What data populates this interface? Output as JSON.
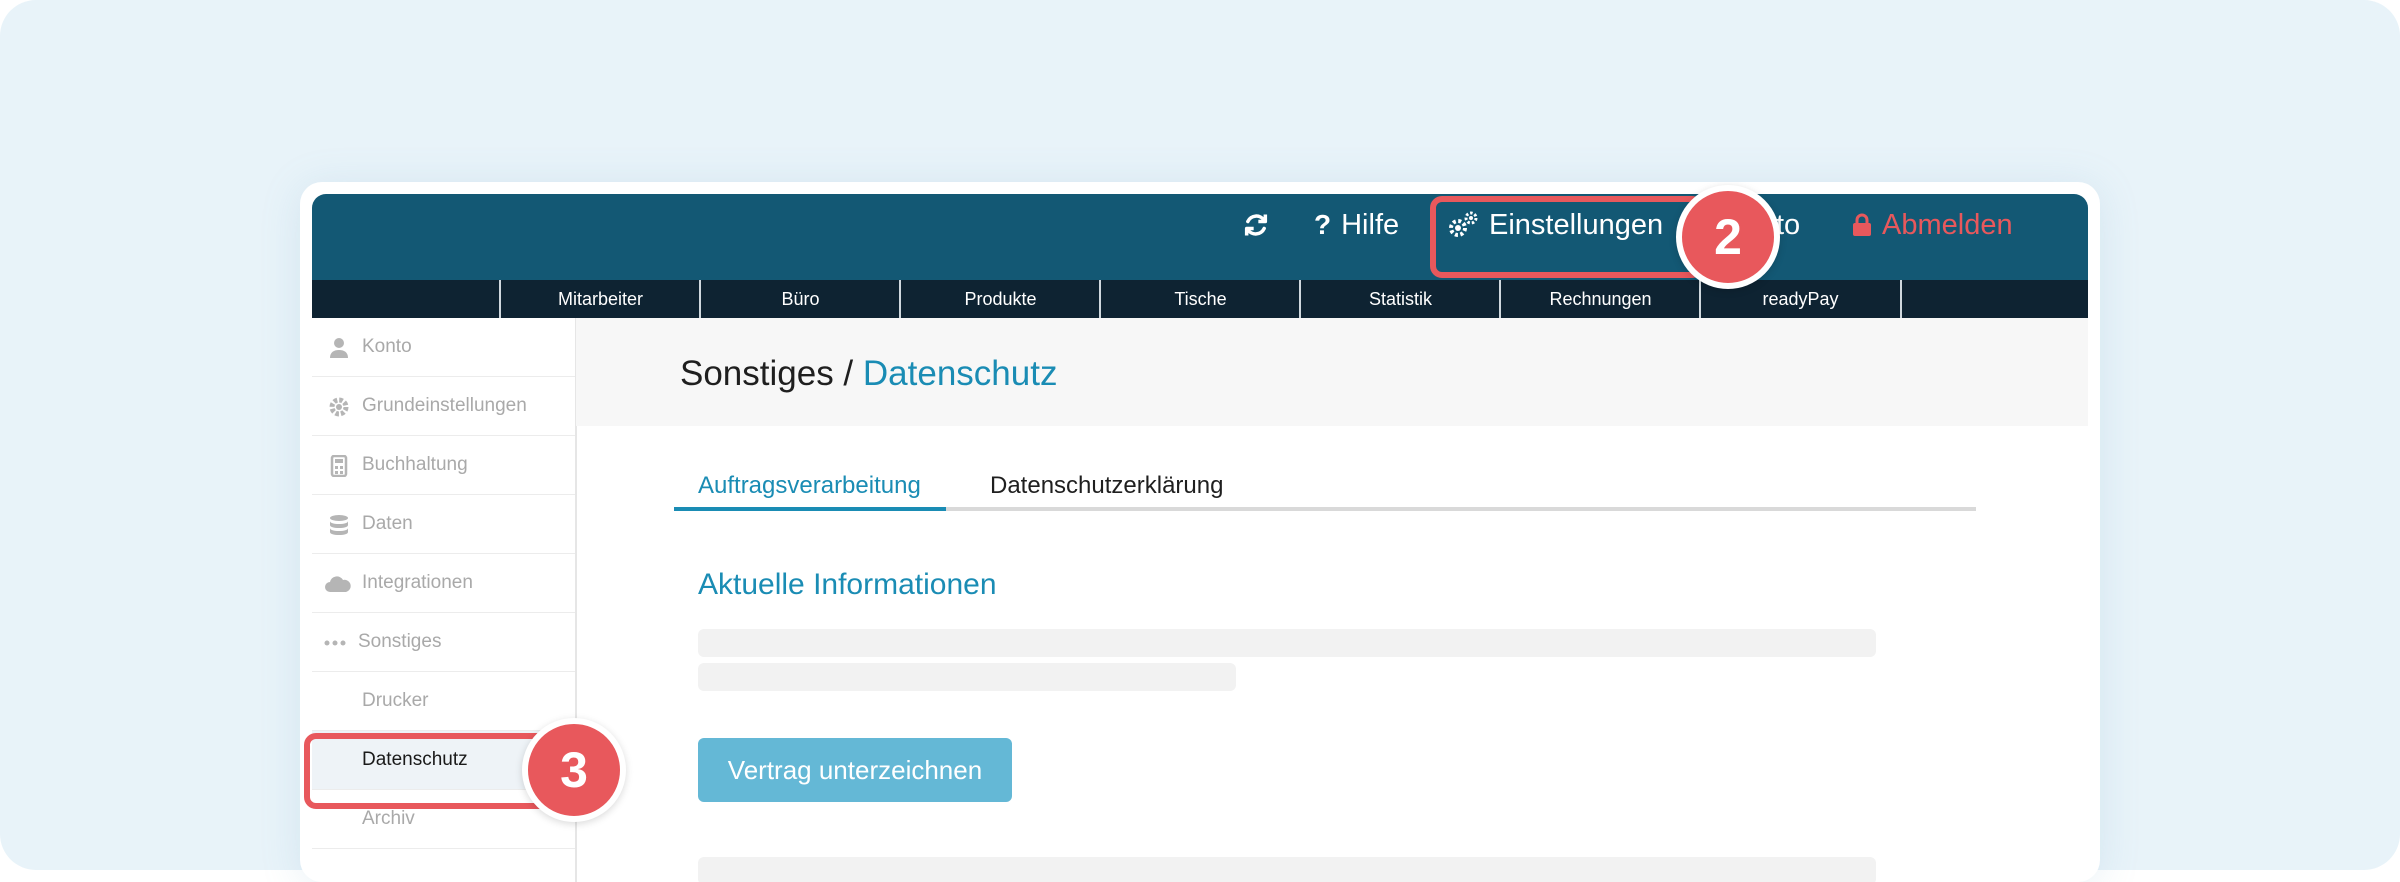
{
  "topbar": {
    "refresh_icon": "refresh-icon",
    "help_label": "Hilfe",
    "settings_label": "Einstellungen",
    "account_label": "to",
    "logout_label": "Abmelden"
  },
  "subnav": {
    "tabs": [
      "Mitarbeiter",
      "Büro",
      "Produkte",
      "Tische",
      "Statistik",
      "Rechnungen",
      "readyPay"
    ]
  },
  "sidebar": {
    "items": [
      {
        "label": "Konto",
        "icon": "user-icon"
      },
      {
        "label": "Grundeinstellungen",
        "icon": "gear-icon"
      },
      {
        "label": "Buchhaltung",
        "icon": "calculator-icon"
      },
      {
        "label": "Daten",
        "icon": "database-icon"
      },
      {
        "label": "Integrationen",
        "icon": "cloud-icon"
      },
      {
        "label": "Sonstiges",
        "icon": "ellipsis-icon"
      }
    ],
    "sub_items": [
      {
        "label": "Drucker"
      },
      {
        "label": "Datenschutz"
      },
      {
        "label": "Archiv"
      }
    ]
  },
  "main": {
    "breadcrumb_parent": "Sonstiges /",
    "breadcrumb_current": "Datenschutz",
    "tabs": [
      "Auftragsverarbeitung",
      "Datenschutzerklärung"
    ],
    "section_title": "Aktuelle Informationen",
    "sign_button": "Vertrag unterzeichnen"
  },
  "annotations": {
    "step2": "2",
    "step3": "3"
  },
  "colors": {
    "topbar": "#135874",
    "subnav": "#0e2332",
    "accent": "#1a8cb4",
    "highlight": "#e8585c",
    "button": "#64b8d6"
  }
}
